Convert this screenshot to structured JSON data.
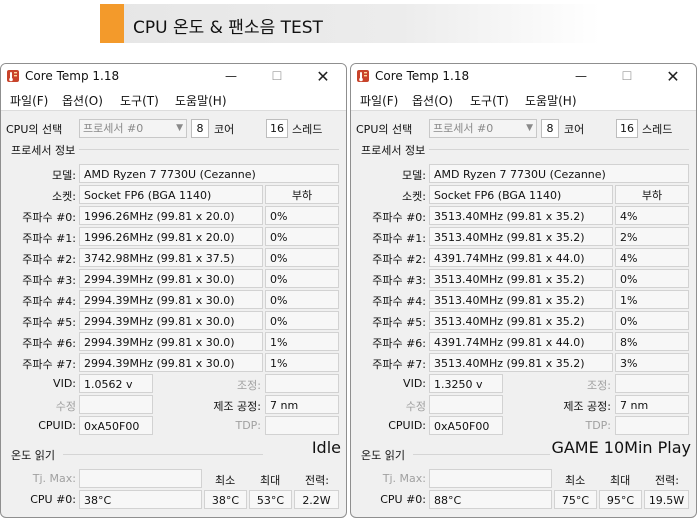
{
  "banner": {
    "title": "CPU 온도 & 팬소음 TEST"
  },
  "colors": {
    "accent": "#f39a2b",
    "window_bg": "#f0f0f0"
  },
  "labels": {
    "cpu_select": "CPU의 선택",
    "cores": "코어",
    "threads": "스레드",
    "processor_info": "프로세서 정보",
    "model": "모델:",
    "socket": "소켓:",
    "load": "부하",
    "vid": "VID:",
    "revision": "수정",
    "modulation": "조정:",
    "lithography": "제조 공정:",
    "cpuid": "CPUID:",
    "tdp": "TDP:",
    "temp_readings": "온도 읽기",
    "tj_max": "Tj. Max:",
    "min": "최소",
    "max": "최대",
    "power": "전력:",
    "cpu0": "CPU #0:",
    "freq": [
      "주파수 #0:",
      "주파수 #1:",
      "주파수 #2:",
      "주파수 #3:",
      "주파수 #4:",
      "주파수 #5:",
      "주파수 #6:",
      "주파수 #7:"
    ]
  },
  "windows": [
    {
      "title": "Core Temp 1.18",
      "menu": [
        "파일(F)",
        "옵션(O)",
        "도구(T)",
        "도움말(H)"
      ],
      "processor": "프로세서 #0",
      "cores": "8",
      "threads": "16",
      "model": "AMD Ryzen 7 7730U (Cezanne)",
      "socket": "Socket FP6 (BGA 1140)",
      "freqs": [
        {
          "value": "1996.26MHz (99.81 x 20.0)",
          "load": "0%"
        },
        {
          "value": "1996.26MHz (99.81 x 20.0)",
          "load": "0%"
        },
        {
          "value": "3742.98MHz (99.81 x 37.5)",
          "load": "0%"
        },
        {
          "value": "2994.39MHz (99.81 x 30.0)",
          "load": "0%"
        },
        {
          "value": "2994.39MHz (99.81 x 30.0)",
          "load": "0%"
        },
        {
          "value": "2994.39MHz (99.81 x 30.0)",
          "load": "0%"
        },
        {
          "value": "2994.39MHz (99.81 x 30.0)",
          "load": "1%"
        },
        {
          "value": "2994.39MHz (99.81 x 30.0)",
          "load": "1%"
        }
      ],
      "vid": "1.0562 v",
      "lithography": "7 nm",
      "cpuid": "0xA50F00",
      "cpu0": {
        "temp": "38°C",
        "min": "38°C",
        "max": "53°C",
        "power": "2.2W"
      },
      "overlay": "Idle"
    },
    {
      "title": "Core Temp 1.18",
      "menu": [
        "파일(F)",
        "옵션(O)",
        "도구(T)",
        "도움말(H)"
      ],
      "processor": "프로세서 #0",
      "cores": "8",
      "threads": "16",
      "model": "AMD Ryzen 7 7730U (Cezanne)",
      "socket": "Socket FP6 (BGA 1140)",
      "freqs": [
        {
          "value": "3513.40MHz (99.81 x 35.2)",
          "load": "4%"
        },
        {
          "value": "3513.40MHz (99.81 x 35.2)",
          "load": "2%"
        },
        {
          "value": "4391.74MHz (99.81 x 44.0)",
          "load": "4%"
        },
        {
          "value": "3513.40MHz (99.81 x 35.2)",
          "load": "0%"
        },
        {
          "value": "3513.40MHz (99.81 x 35.2)",
          "load": "1%"
        },
        {
          "value": "3513.40MHz (99.81 x 35.2)",
          "load": "0%"
        },
        {
          "value": "4391.74MHz (99.81 x 44.0)",
          "load": "8%"
        },
        {
          "value": "3513.40MHz (99.81 x 35.2)",
          "load": "3%"
        }
      ],
      "vid": "1.3250 v",
      "lithography": "7 nm",
      "cpuid": "0xA50F00",
      "cpu0": {
        "temp": "88°C",
        "min": "75°C",
        "max": "95°C",
        "power": "19.5W"
      },
      "overlay": "GAME 10Min Play"
    }
  ]
}
